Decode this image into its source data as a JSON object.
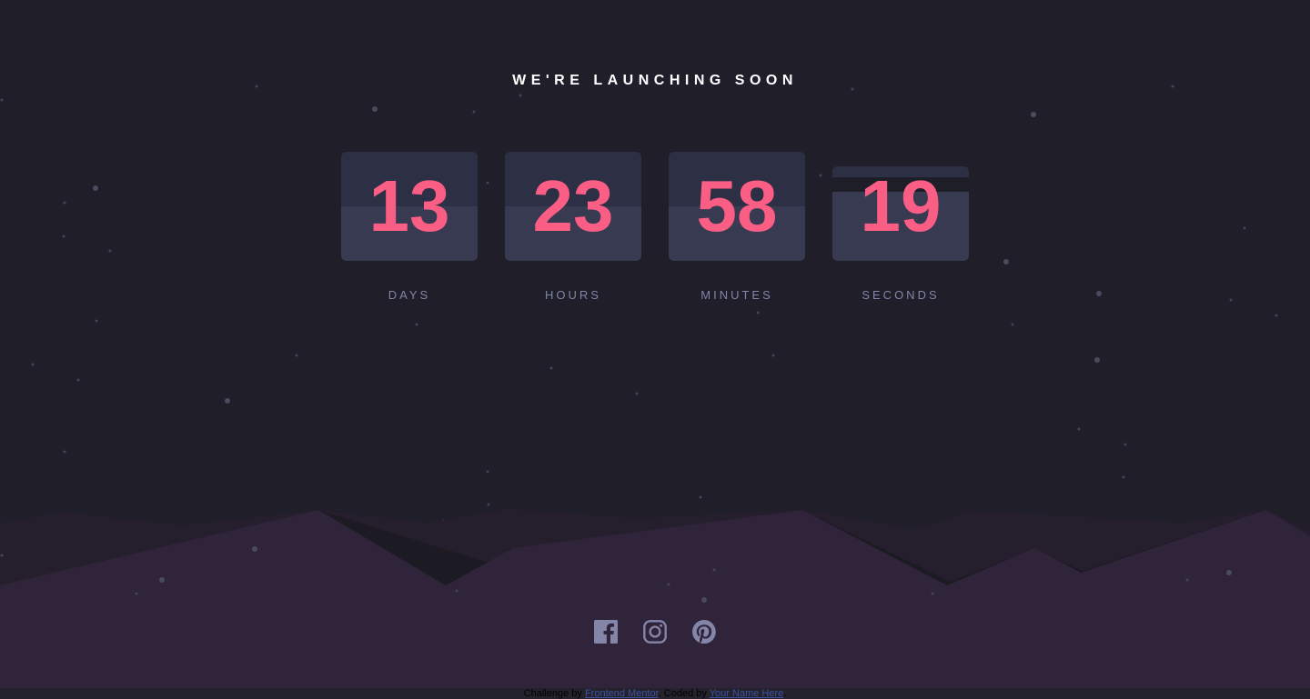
{
  "headline": "WE'RE LAUNCHING SOON",
  "countdown": [
    {
      "value": "13",
      "label": "DAYS"
    },
    {
      "value": "23",
      "label": "HOURS"
    },
    {
      "value": "58",
      "label": "MINUTES"
    },
    {
      "value": "19",
      "label": "SECONDS"
    }
  ],
  "socials": [
    {
      "icon": "facebook-icon"
    },
    {
      "icon": "instagram-icon"
    },
    {
      "icon": "pinterest-icon"
    }
  ],
  "attribution": {
    "prefix": "Challenge by ",
    "mentor_link": "Frontend Mentor",
    "middle": ". Coded by ",
    "author_link": "Your Name Here",
    "suffix": "."
  },
  "colors": {
    "background": "#1f1e29",
    "accent": "#fb5e84",
    "label": "#8385a9",
    "card": "#343650",
    "hills": "#2f2439",
    "icon": "#8385a9"
  }
}
